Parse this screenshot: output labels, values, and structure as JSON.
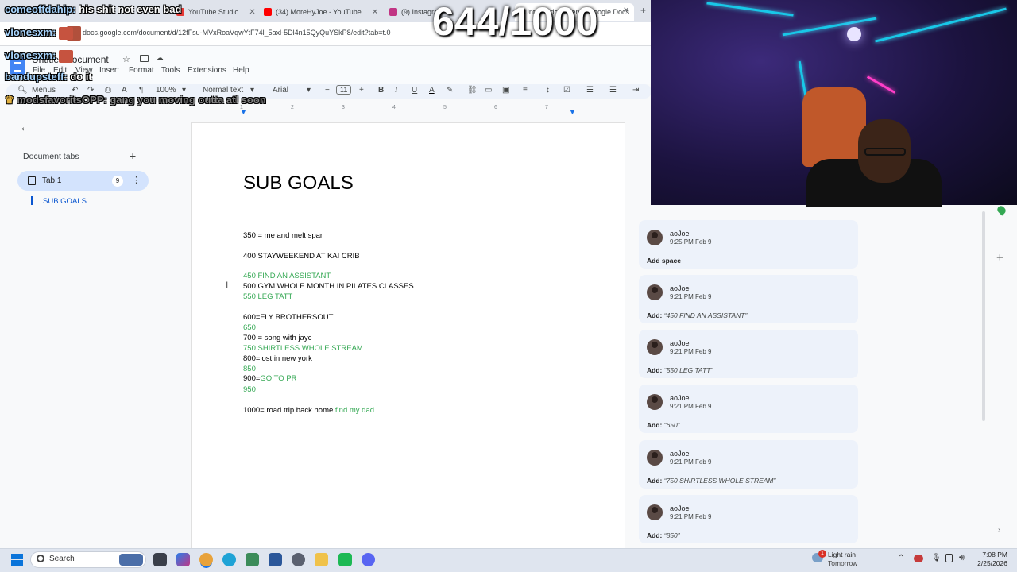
{
  "browser": {
    "tabs": [
      {
        "label": "YouTube Studio",
        "icon": "youtube-studio-icon"
      },
      {
        "label": "(34) MoreHyJoe - YouTube",
        "icon": "youtube-icon"
      },
      {
        "label": "(9) Instagram",
        "icon": "instagram-icon"
      },
      {
        "label": "Untitled document - Google Docs",
        "icon": "docs-icon"
      }
    ],
    "url": "docs.google.com/document/d/12fFsu-MVxRoaVqwYtF74l_5axl-5Dl4n15QyQuYSkP8/edit?tab=t.0"
  },
  "docs": {
    "title": "Untitled document",
    "menu": [
      "File",
      "Edit",
      "View",
      "Insert",
      "Format",
      "Tools",
      "Extensions",
      "Help"
    ],
    "toolbar": {
      "menus_label": "Menus",
      "zoom": "100%",
      "style": "Normal text",
      "font": "Arial",
      "font_size": "11",
      "minus": "−",
      "plus": "+"
    },
    "ruler": [
      "1",
      "2",
      "3",
      "4",
      "5",
      "6",
      "7"
    ],
    "left_panel": {
      "heading": "Document tabs",
      "add": "+",
      "tab_label": "Tab 1",
      "tab_count": "9",
      "outline_item": "SUB GOALS"
    },
    "page": {
      "title": "SUB GOALS",
      "lines": [
        {
          "text": "350  = me and melt spar",
          "color": "#000000"
        },
        {
          "text": "400 STAYWEEKEND  AT KAI CRIB",
          "color": "#000000"
        },
        {
          "text": "450  FIND AN ASSISTANT",
          "color": "#34a853"
        },
        {
          "text": "500 GYM WHOLE MONTH IN PILATES CLASSES",
          "color": "#000000"
        },
        {
          "text": "550 LEG TATT",
          "color": "#34a853"
        },
        {
          "text": " 600=FLY BROTHERSOUT",
          "color": "#000000"
        },
        {
          "text": "650",
          "color": "#34a853"
        },
        {
          "text": "700 = song with jayc",
          "color": "#000000"
        },
        {
          "text": "750 SHIRTLESS WHOLE STREAM",
          "color": "#34a853"
        },
        {
          "text": "800=lost in new york",
          "color": "#000000"
        },
        {
          "text": "850",
          "color": "#34a853"
        },
        {
          "text": "950",
          "color": "#34a853"
        }
      ],
      "line_900_prefix": "900=",
      "line_900_suffix": "GO TO PR",
      "line_1000_prefix": "1000= road trip back home ",
      "line_1000_suffix": "find my dad"
    },
    "comments": [
      {
        "author": "aoJoe",
        "time": "9:25 PM Feb 9",
        "prefix": "Add space",
        "quote": ""
      },
      {
        "author": "aoJoe",
        "time": "9:21 PM Feb 9",
        "prefix": "Add:",
        "quote": "“450 FIND AN ASSISTANT”"
      },
      {
        "author": "aoJoe",
        "time": "9:21 PM Feb 9",
        "prefix": "Add:",
        "quote": "“550 LEG TATT”"
      },
      {
        "author": "aoJoe",
        "time": "9:21 PM Feb 9",
        "prefix": "Add:",
        "quote": "“650”"
      },
      {
        "author": "aoJoe",
        "time": "9:21 PM Feb 9",
        "prefix": "Add:",
        "quote": "“750 SHIRTLESS WHOLE STREAM”"
      },
      {
        "author": "aoJoe",
        "time": "9:21 PM Feb 9",
        "prefix": "Add:",
        "quote": "“850”"
      }
    ]
  },
  "stream": {
    "counter": "644/1000",
    "chat": [
      {
        "user": "comeoffdahip:",
        "msg": " his shit not even bad"
      },
      {
        "user": "vlonesxm:",
        "msg": ""
      },
      {
        "user": "vlonesxm:",
        "msg": ""
      },
      {
        "user": "bandupsteff:",
        "msg": " do it"
      },
      {
        "user": "modsfavoritsOPP:",
        "msg": " gang you moving outta atl soon"
      }
    ]
  },
  "taskbar": {
    "search_label": "Search",
    "weather": "Light rain",
    "weather_sub": "Tomorrow",
    "weather_badge": "1",
    "time": "7:08 PM",
    "date": "2/25/2026"
  }
}
